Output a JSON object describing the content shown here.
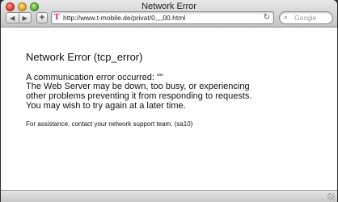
{
  "window": {
    "title": "Network Error"
  },
  "toolbar": {
    "back_glyph": "◀",
    "forward_glyph": "▶",
    "add_glyph": "+",
    "url": "http://www.t-mobile.de/privat/0,,,,00.html",
    "favicon_glyph": "T",
    "reload_glyph": "↻",
    "search_placeholder": "Google",
    "search_glyph": "⌕"
  },
  "page": {
    "heading": "Network Error (tcp_error)",
    "line1": "A communication error occurred: \"\"",
    "paragraph": "The Web Server may be down, too busy, or experiencing other problems preventing it from responding to requests. You may wish to try again at a later time.",
    "assistance": "For assistance, contact your network support team. (sa10)"
  },
  "colors": {
    "brand_magenta": "#e20074"
  }
}
